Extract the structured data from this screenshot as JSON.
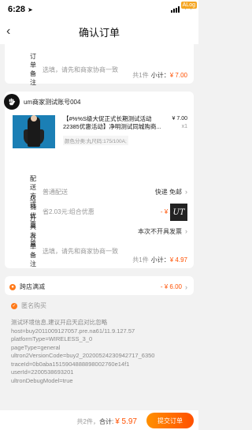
{
  "status": {
    "time": "6:28",
    "alog": "ALog"
  },
  "nav": {
    "title": "确认订单"
  },
  "top_card": {
    "remark_label": "订单备注",
    "remark_placeholder": "选填，请先和商家协商一致",
    "summary_count": "共1件",
    "summary_label": "小计：",
    "summary_price": "¥ 7.00"
  },
  "shop": {
    "name": "um商家测试账号004",
    "product": {
      "title": "【#%%S级大促正式长期测试活动22385优惠活动】净明测试同城购商...",
      "spec": "颜色分类:丸尺码:175/100A;",
      "price": "¥ 7.00",
      "qty": "x1"
    },
    "delivery_label": "配送方式",
    "delivery_value": "普通配送",
    "delivery_right": "快递 免邮",
    "discount_label": "店铺优惠",
    "discount_value": "省2.03元:组合优惠",
    "discount_amount": "- ¥ 2.03",
    "invoice_label": "开具发票",
    "invoice_value": "本次不开具发票",
    "remark_label": "订单备注",
    "remark_placeholder": "选填，请先和商家协商一致",
    "logo_text": "UT",
    "summary_count": "共1件",
    "summary_label": "小计：",
    "summary_price": "¥ 4.97"
  },
  "cross_store": {
    "label": "跨店满减",
    "amount": "- ¥ 6.00"
  },
  "anonymous": {
    "label": "匿名购买"
  },
  "debug_lines": [
    "测试环境信息,建议开启天启对比忽略",
    "host=buy2011009127057.pre.na61/11.9.127.57",
    "platformType=WIRELESS_3_0",
    "pageType=general",
    "ultron2VersionCode=buy2_20200524230942717_6350",
    "traceId=0b0aba1515904888898002760e14f1",
    "userId=2200538693201",
    "ultronDebugModel=true"
  ],
  "bottom": {
    "count": "共2件，",
    "total_label": "合计:",
    "total_price": "¥ 5.97",
    "submit": "提交订单"
  },
  "colors": {
    "accent": "#ff5000",
    "gradient_start": "#ff9000"
  }
}
